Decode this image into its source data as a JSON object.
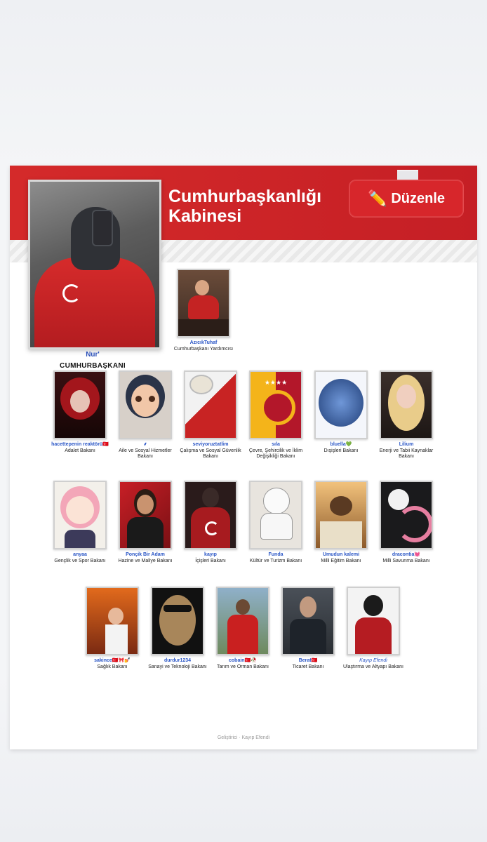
{
  "header": {
    "title": "Cumhurbaşkanlığı Kabinesi",
    "edit_button": "Düzenle",
    "edit_icon": "✏️",
    "accent": "#d42a2a"
  },
  "president": {
    "name": "Nur'",
    "role": "CUMHURBAŞKANI"
  },
  "vice_president": {
    "name": "AzıcıkTuhaf",
    "role": "Cumhurbaşkanı Yardımcısı"
  },
  "ministers_row1": [
    {
      "name": "hacettepenin reaktörü🇹🇷",
      "role": "Adalet Bakanı"
    },
    {
      "name": "⸙",
      "role": "Aile ve Sosyal Hizmetler Bakanı"
    },
    {
      "name": "seviyoruztatlim",
      "role": "Çalışma ve Sosyal Güvenlik Bakanı"
    },
    {
      "name": "sıla",
      "role": "Çevre, Şehircilik ve İklim Değişikliği Bakanı"
    },
    {
      "name": "bluella💚",
      "role": "Dışişleri Bakanı"
    },
    {
      "name": "Lilium",
      "role": "Enerji ve Tabii Kaynaklar Bakanı"
    }
  ],
  "ministers_row2": [
    {
      "name": "anyaa",
      "role": "Gençlik ve Spor Bakanı"
    },
    {
      "name": "Ponçik Bir Adam",
      "role": "Hazine ve Maliye Bakanı"
    },
    {
      "name": "kayıp",
      "role": "İçişleri Bakanı"
    },
    {
      "name": "Funda",
      "role": "Kültür ve Turizm Bakanı"
    },
    {
      "name": "Umudun kalemi",
      "role": "Milli Eğitim Bakanı"
    },
    {
      "name": "dracontia💓",
      "role": "Milli Savunma Bakanı"
    }
  ],
  "ministers_row3": [
    {
      "name": "sakince🇹🇷🎀💅",
      "role": "Sağlık Bakanı"
    },
    {
      "name": "durdur1234",
      "role": "Sanayi ve Teknoloji Bakanı"
    },
    {
      "name": "cobain🇹🇷🥀",
      "role": "Tarım ve Orman Bakanı"
    },
    {
      "name": "Berat🇹🇷",
      "role": "Ticaret Bakanı"
    },
    {
      "name": "Kayıp Efendi",
      "role": "Ulaştırma ve Altyapı Bakanı"
    }
  ],
  "footer": {
    "text": "Geliştirici · Kayıp Efendi"
  }
}
